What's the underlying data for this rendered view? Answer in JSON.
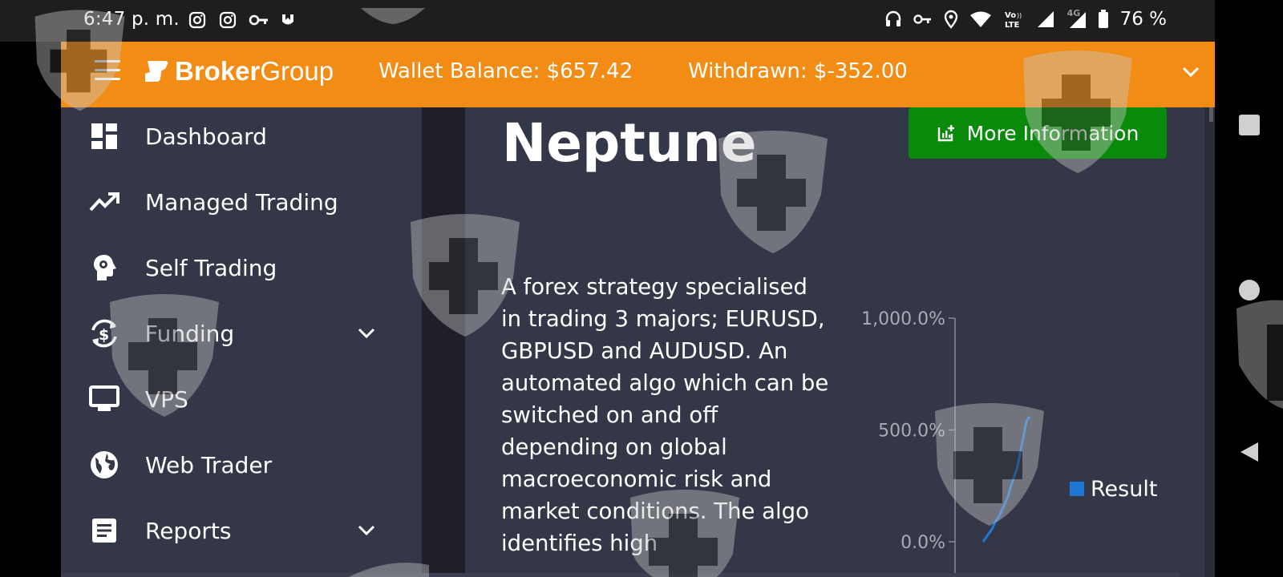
{
  "status_bar": {
    "time": "6:47 p. m.",
    "battery": "76 %",
    "left_icons": [
      "instagram-icon",
      "instagram-icon",
      "key-icon",
      "shield-app-icon"
    ],
    "right_icons": [
      "headphones-icon",
      "key-icon",
      "location-icon",
      "wifi-icon",
      "volte-icon",
      "signal-icon",
      "signal-4g-icon",
      "battery-icon"
    ],
    "network_label": "4G"
  },
  "header": {
    "brand_bold": "Broker",
    "brand_light": "Group",
    "wallet_balance": "Wallet Balance: $657.42",
    "withdrawn": "Withdrawn: $-352.00",
    "bg_color": "#f28c14"
  },
  "sidebar": {
    "items": [
      {
        "label": "Dashboard",
        "icon": "dashboard-icon",
        "expandable": false
      },
      {
        "label": "Managed Trading",
        "icon": "trending-up-icon",
        "expandable": false
      },
      {
        "label": "Self Trading",
        "icon": "head-gear-icon",
        "expandable": false
      },
      {
        "label": "Funding",
        "icon": "dollar-cycle-icon",
        "expandable": true
      },
      {
        "label": "VPS",
        "icon": "monitor-icon",
        "expandable": false
      },
      {
        "label": "Web Trader",
        "icon": "globe-icon",
        "expandable": false
      },
      {
        "label": "Reports",
        "icon": "document-icon",
        "expandable": true
      }
    ]
  },
  "main": {
    "title": "Neptune",
    "more_info_label": "More Information",
    "description": "A forex strategy specialised in trading 3 majors; EURUSD, GBPUSD and AUDUSD. An automated algo which can be switched on and off depending on global macroeconomic risk and market conditions. The algo identifies high"
  },
  "chart_data": {
    "type": "line",
    "series": [
      {
        "name": "Result",
        "color": "#1f77d4",
        "x": [
          0,
          1,
          2,
          3,
          4,
          5,
          6,
          7,
          8,
          9,
          10,
          11,
          12,
          13,
          14,
          15
        ],
        "values": [
          0,
          20,
          40,
          60,
          90,
          110,
          140,
          170,
          200,
          250,
          290,
          330,
          400,
          470,
          540,
          560
        ]
      }
    ],
    "y_ticks": [
      "1,000.0%",
      "500.0%",
      "0.0%"
    ],
    "ylim": [
      0,
      1000
    ],
    "legend": "right"
  },
  "nav_buttons": [
    "recent-apps-button",
    "home-button",
    "back-button"
  ]
}
